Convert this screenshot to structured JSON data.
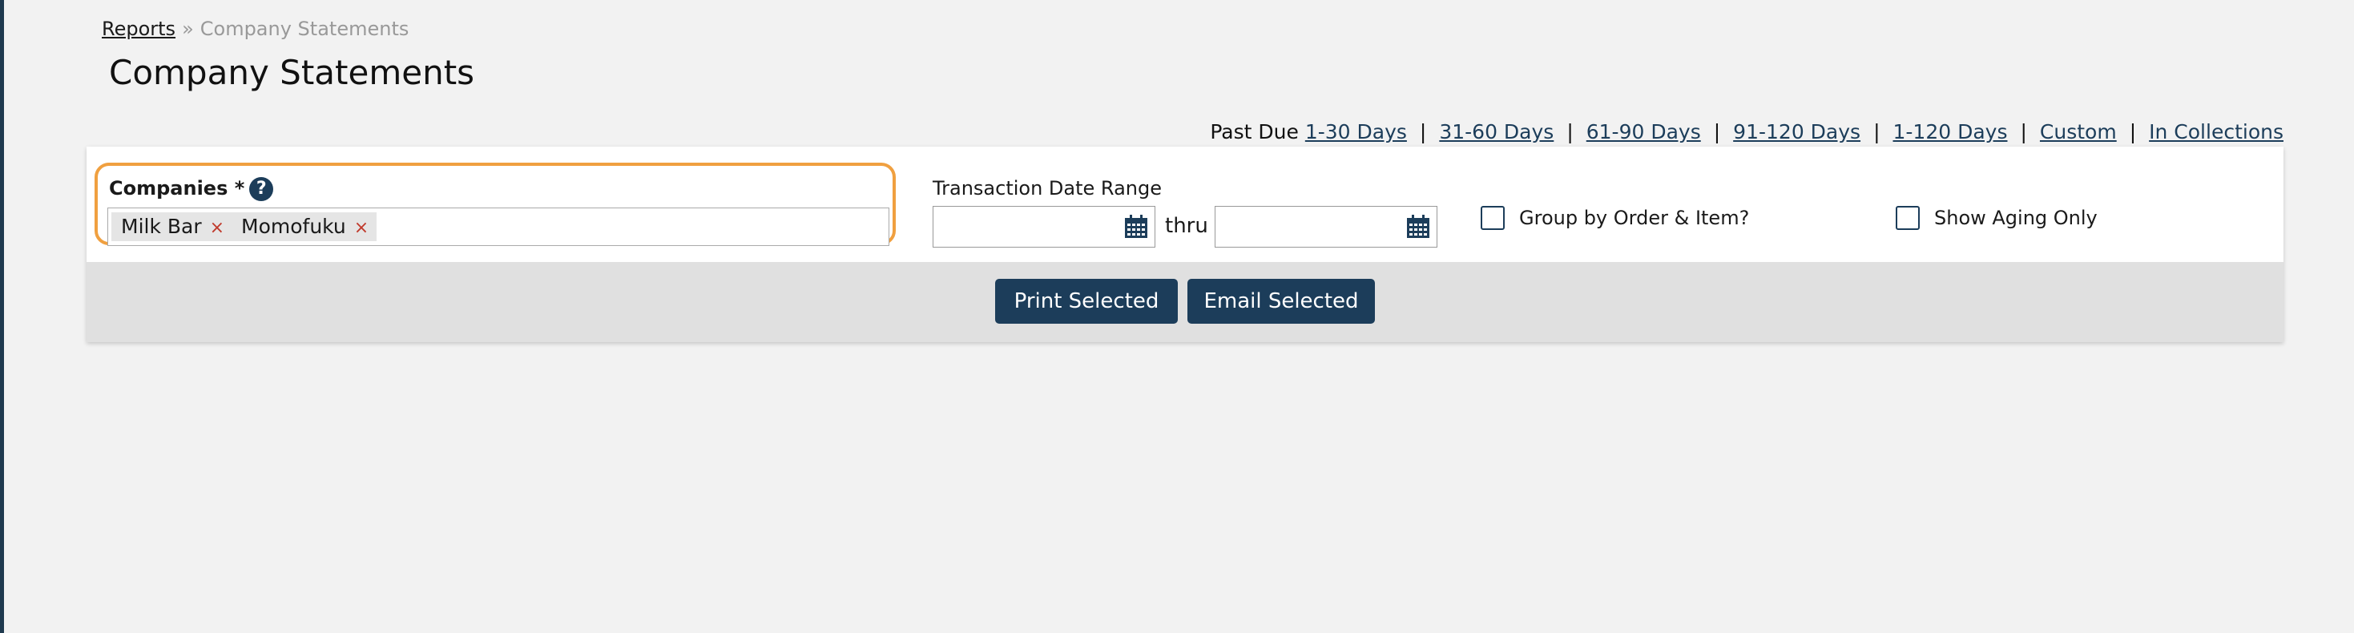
{
  "breadcrumb": {
    "parent": "Reports",
    "separator": "»",
    "current": "Company Statements"
  },
  "page": {
    "title": "Company Statements"
  },
  "past_due": {
    "label": "Past Due",
    "links": [
      "1-30 Days",
      "31-60 Days",
      "61-90 Days",
      "91-120 Days",
      "1-120 Days",
      "Custom",
      "In Collections"
    ],
    "separator": "|"
  },
  "filters": {
    "companies": {
      "label": "Companies *",
      "help_icon": "?",
      "selected": [
        "Milk Bar",
        "Momofuku"
      ],
      "remove_glyph": "×"
    },
    "transaction_date_range": {
      "label": "Transaction Date Range",
      "from_value": "",
      "thru_label": "thru",
      "to_value": ""
    },
    "group_by_order_item": {
      "label": "Group by Order & Item?",
      "checked": false
    },
    "show_aging_only": {
      "label": "Show Aging Only",
      "checked": false
    }
  },
  "actions": {
    "print_selected": "Print Selected",
    "email_selected": "Email Selected"
  },
  "colors": {
    "accent": "#1c3d5a",
    "highlight": "#f0a040",
    "remove": "#c0392b"
  }
}
